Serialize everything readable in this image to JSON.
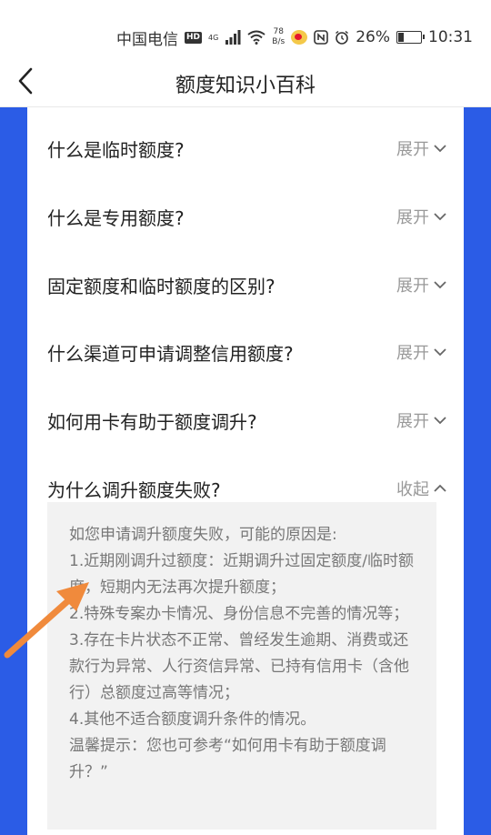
{
  "status_bar": {
    "carrier": "中国电信",
    "hd": "HD",
    "network": "4G",
    "speed_value": "78",
    "speed_unit": "B/s",
    "battery": "26%",
    "time": "10:31"
  },
  "header": {
    "title": "额度知识小百科"
  },
  "faq": [
    {
      "question": "什么是临时额度?",
      "toggle": "展开"
    },
    {
      "question": "什么是专用额度?",
      "toggle": "展开"
    },
    {
      "question": "固定额度和临时额度的区别?",
      "toggle": "展开"
    },
    {
      "question": "什么渠道可申请调整信用额度?",
      "toggle": "展开"
    },
    {
      "question": "如何用卡有助于额度调升?",
      "toggle": "展开"
    },
    {
      "question": "为什么调升额度失败?",
      "toggle": "收起"
    }
  ],
  "answer": {
    "lines": [
      "如您申请调升额度失败，可能的原因是:",
      "1.近期刚调升过额度：近期调升过固定额度/临时额度，短期内无法再次提升额度；",
      "2.特殊专案办卡情况、身份信息不完善的情况等；",
      "3.存在卡片状态不正常、曾经发生逾期、消费或还款行为异常、人行资信异常、已持有信用卡（含他行）总额度过高等情况；",
      "4.其他不适合额度调升条件的情况。",
      "温馨提示：您也可参考“如何用卡有助于额度调升？”"
    ]
  },
  "colors": {
    "accent_blue": "#2b5ce6",
    "arrow_orange": "#f08a3c"
  }
}
